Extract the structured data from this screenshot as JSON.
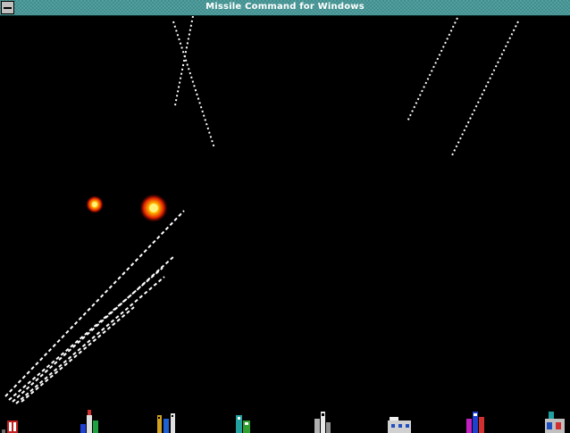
{
  "window": {
    "title": "Missile Command for Windows",
    "accent_titlebar": "#3f8f8f",
    "background": "#000000"
  },
  "icons": {
    "system_menu": "system-menu-icon",
    "explosion": "explosion-icon",
    "city": "city-icon",
    "launcher": "missile-launcher-icon"
  },
  "colors": {
    "missile_trail": "#ffffff",
    "explosion_core": "#ffd000",
    "explosion_outer": "#e02000"
  },
  "cities": [
    {
      "name": "city-1"
    },
    {
      "name": "city-2"
    },
    {
      "name": "city-3"
    },
    {
      "name": "city-4"
    },
    {
      "name": "city-5"
    },
    {
      "name": "city-6"
    },
    {
      "name": "city-7"
    },
    {
      "name": "city-8"
    }
  ]
}
